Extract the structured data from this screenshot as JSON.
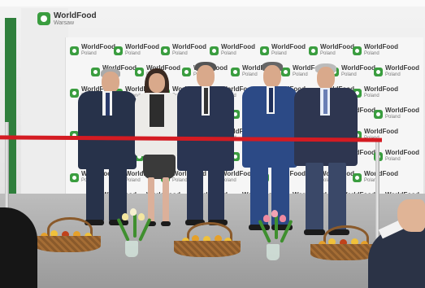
{
  "photo": {
    "brand": {
      "name": "WorldFood",
      "city_top": "Warsaw",
      "country": "Poland"
    },
    "colors": {
      "brand_green": "#3a9d3f",
      "ribbon_red": "#d41b22"
    }
  }
}
